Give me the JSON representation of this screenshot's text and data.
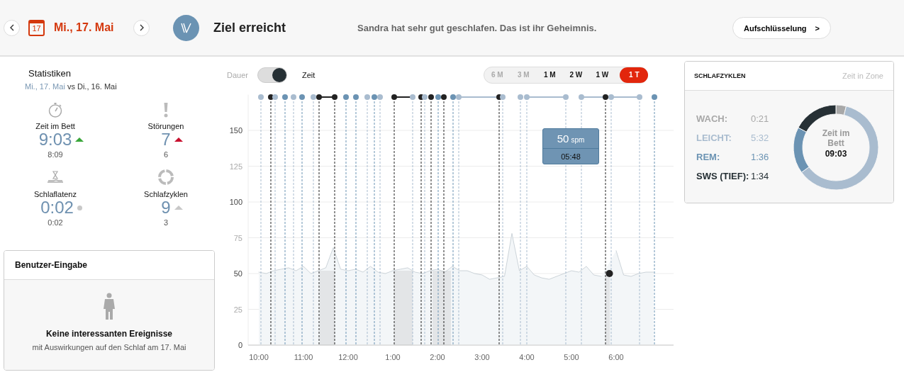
{
  "header": {
    "date_day": "17",
    "date": "Mi., 17. Mai",
    "title": "Ziel erreicht",
    "message": "Sandra hat sehr gut geschlafen. Das ist ihr Geheimnis.",
    "button": {
      "label": "Aufschlüsselung",
      "arrow": ">"
    }
  },
  "stats": {
    "title": "Statistiken",
    "current": "Mi., 17. Mai",
    "vs": "vs",
    "previous": "Di., 16. Mai",
    "items": [
      {
        "kind": "stopwatch",
        "label": "Zeit im Bett",
        "value": "9:03",
        "trend": {
          "kind": "up",
          "color": "#3aa63a"
        },
        "previous": "8:09"
      },
      {
        "kind": "alert",
        "label": "Störungen",
        "value": "7",
        "trend": {
          "kind": "up",
          "color": "#c8102e"
        },
        "previous": "6"
      },
      {
        "kind": "latency",
        "label": "Schlaflatenz",
        "value": "0:02",
        "trend": {
          "kind": "same",
          "color": "#c8c8c8"
        },
        "previous": "0:02"
      },
      {
        "kind": "cycle",
        "label": "Schlafzyklen",
        "value": "9",
        "trend": {
          "kind": "up",
          "color": "#c8c8c8"
        },
        "previous": "3"
      }
    ]
  },
  "user_input": {
    "title": "Benutzer-Eingabe",
    "headline": "Keine interessanten Ereignisse",
    "text": "mit Auswirkungen auf den Schlaf am 17. Mai"
  },
  "toggle": {
    "left_label": "Dauer",
    "right_label": "Zeit",
    "on": true
  },
  "ranges": [
    {
      "label": "6 M",
      "selected": false,
      "disabled": true
    },
    {
      "label": "3 M",
      "selected": false,
      "disabled": true
    },
    {
      "label": "1 M",
      "selected": false,
      "disabled": false
    },
    {
      "label": "2 W",
      "selected": false,
      "disabled": false
    },
    {
      "label": "1 W",
      "selected": false,
      "disabled": false
    },
    {
      "label": "1 T",
      "selected": true,
      "disabled": false
    }
  ],
  "heart_chart": {
    "chart_data": {
      "type": "area",
      "grid": true,
      "ylim": [
        0,
        175
      ],
      "yticks": [
        0,
        25,
        50,
        75,
        100,
        125,
        150
      ],
      "categories": [
        "10:00",
        null,
        null,
        null,
        null,
        null,
        "11:00",
        null,
        null,
        null,
        null,
        null,
        "12:00",
        null,
        null,
        null,
        null,
        null,
        "1:00",
        null,
        null,
        null,
        null,
        null,
        "2:00",
        null,
        null,
        null,
        null,
        null,
        "3:00",
        null,
        null,
        null,
        null,
        null,
        "4:00",
        null,
        null,
        null,
        null,
        null,
        "5:00",
        null,
        null,
        null,
        null,
        null,
        "6:00",
        null,
        null,
        null,
        null,
        null
      ],
      "series": [
        {
          "name": "spm",
          "color": "#b9c3ca",
          "values": [
            51,
            50,
            52,
            53,
            54,
            52,
            55,
            50,
            52,
            54,
            68,
            53,
            52,
            53,
            51,
            55,
            51,
            50,
            52,
            53,
            54,
            51,
            50,
            52,
            53,
            51,
            55,
            52,
            52,
            50,
            49,
            46,
            47,
            48,
            78,
            52,
            55,
            49,
            47,
            46,
            48,
            50,
            52,
            51,
            55,
            49,
            48,
            null,
            66,
            49,
            48,
            50,
            51,
            51
          ]
        }
      ]
    },
    "tooltip": {
      "value": "50",
      "time": "05:48"
    }
  },
  "zones": {
    "title": "SCHLAFZYKLEN",
    "subtitle": "Zeit in Zone",
    "rows": [
      {
        "separator": ":",
        "value": "0:21",
        "color": "#a8a8a8"
      },
      {
        "separator": ":",
        "value": "5:32",
        "color": "#a9bccf"
      },
      {
        "separator": ":",
        "value": "1:36",
        "color": "#6b93b3"
      },
      {
        "separator": ":",
        "value": "1:34",
        "color": "#263035"
      }
    ],
    "center_label": "Zeit im Bett",
    "center_value": "09:03",
    "chart_data": {
      "type": "donut",
      "categories": [
        "WACH",
        "LEICHT",
        "REM",
        "SWS (TIEF)"
      ],
      "values": [
        3.9,
        61.1,
        17.7,
        17.3
      ]
    }
  }
}
